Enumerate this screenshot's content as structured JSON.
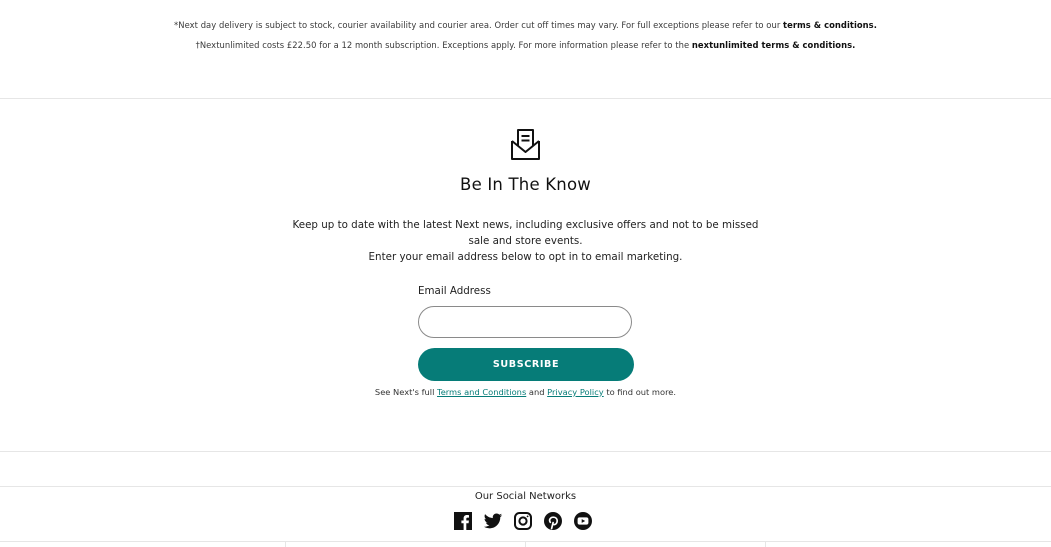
{
  "disclaimers": {
    "line1_text": "*Next day delivery is subject to stock, courier availability and courier area.  Order cut off times may vary.  For full exceptions please refer to our ",
    "line1_link": "terms & conditions.",
    "line2_text": "†Nextunlimited costs £22.50 for a 12 month subscription. Exceptions apply. For more information please refer to the ",
    "line2_link": "nextunlimited terms & conditions."
  },
  "newsletter": {
    "icon": "envelope-icon",
    "title": "Be In The Know",
    "description_line1": "Keep up to date with the latest Next news, including exclusive offers and not to be missed",
    "description_line2": "sale and store events.",
    "description_line3": "Enter your email address below to opt in to email marketing.",
    "email_label": "Email Address",
    "email_value": "",
    "subscribe_label": "SUBSCRIBE",
    "terms_prefix": "See Next's full ",
    "terms_link": "Terms and Conditions",
    "terms_and": " and ",
    "privacy_link": "Privacy Policy",
    "terms_suffix": " to find out more."
  },
  "social": {
    "title": "Our Social Networks",
    "networks": [
      "facebook-icon",
      "twitter-icon",
      "instagram-icon",
      "pinterest-icon",
      "youtube-icon"
    ]
  },
  "colors": {
    "accent": "#067c78",
    "text": "#222222",
    "divider": "#e6e6e6"
  }
}
